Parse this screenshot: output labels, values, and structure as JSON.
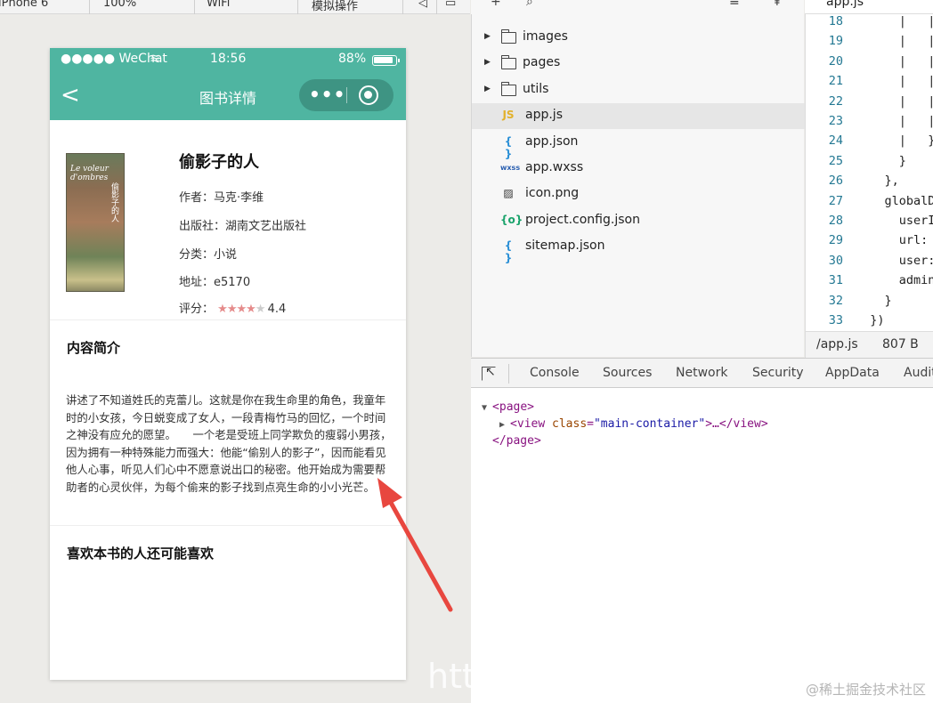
{
  "simulator_toolbar": {
    "device": "iPhone 6",
    "zoom": "100%",
    "network": "WiFi",
    "mode": "模拟操作"
  },
  "phone": {
    "status": {
      "carrier": "●●●●● WeChat",
      "time": "18:56",
      "battery": "88%"
    },
    "nav": {
      "back": "<",
      "title": "图书详情",
      "menu": "•••"
    },
    "book": {
      "cover_title": "Le voleur d'ombres",
      "cover_cn": "偷影子的人",
      "name": "偷影子的人",
      "author_label": "作者：",
      "author": "马克·李维",
      "publisher_label": "出版社：",
      "publisher": "湖南文艺出版社",
      "category_label": "分类：",
      "category": "小说",
      "address_label": "地址：",
      "address": "e5170",
      "rating_label": "评分：",
      "rating_value": "4.4",
      "rating_stars": 4,
      "rating_max": 5
    },
    "intro_title": "内容简介",
    "intro_text": "讲述了不知道姓氏的克蕾儿。这就是你在我生命里的角色，我童年时的小女孩，今日蜕变成了女人，一段青梅竹马的回忆，一个时间之神没有应允的愿望。　　一个老是受班上同学欺负的瘦弱小男孩，因为拥有一种特殊能力而强大：他能“偷别人的影子”，因而能看见他人心事，听见人们心中不愿意说出口的秘密。他开始成为需要帮助者的心灵伙伴，为每个偷来的影子找到点亮生命的小小光芒。",
    "recommend_title": "喜欢本书的人还可能喜欢"
  },
  "file_tree": [
    {
      "name": "images",
      "type": "folder",
      "icon": "folder-icon"
    },
    {
      "name": "pages",
      "type": "folder",
      "icon": "folder-icon"
    },
    {
      "name": "utils",
      "type": "folder",
      "icon": "folder-icon"
    },
    {
      "name": "app.js",
      "type": "file",
      "icon": "JS",
      "selected": true
    },
    {
      "name": "app.json",
      "type": "file",
      "icon": "{ }"
    },
    {
      "name": "app.wxss",
      "type": "file",
      "icon": "wxss"
    },
    {
      "name": "icon.png",
      "type": "file",
      "icon": "image-icon"
    },
    {
      "name": "project.config.json",
      "type": "file",
      "icon": "{o}"
    },
    {
      "name": "sitemap.json",
      "type": "file",
      "icon": "{ }"
    }
  ],
  "editor": {
    "tab": "app.js",
    "lines": [
      {
        "n": "18",
        "t": "      |   |   |"
      },
      {
        "n": "19",
        "t": "      |   |   |"
      },
      {
        "n": "20",
        "t": "      |   |   |"
      },
      {
        "n": "21",
        "t": "      |   |   |"
      },
      {
        "n": "22",
        "t": "      |   |   |"
      },
      {
        "n": "23",
        "t": "      |   |   }"
      },
      {
        "n": "24",
        "t": "      |   })"
      },
      {
        "n": "25",
        "t": "      }"
      },
      {
        "n": "26",
        "t": "    },"
      },
      {
        "n": "27",
        "t": "    globalD"
      },
      {
        "n": "28",
        "t": "      userI"
      },
      {
        "n": "29",
        "t": "      url: "
      },
      {
        "n": "30",
        "t": "      user:"
      },
      {
        "n": "31",
        "t": "      admin"
      },
      {
        "n": "32",
        "t": "    }"
      },
      {
        "n": "33",
        "t": "  })"
      }
    ],
    "status_path": "/app.js",
    "status_size": "807 B"
  },
  "devtools": {
    "tabs": [
      "Console",
      "Sources",
      "Network",
      "Security",
      "AppData",
      "Audit"
    ],
    "dom": {
      "open_tag": "<page>",
      "child_tag_open": "<view",
      "child_attr": "class",
      "child_val": "\"main-container\"",
      "child_rest": ">…</view>",
      "close_tag": "</page>"
    }
  },
  "watermark": {
    "left": "http",
    "right": "@稀土掘金技术社区"
  },
  "colors": {
    "nav_green": "#4fb5a1",
    "arrow_red": "#e8473f",
    "star": "#e58b8b"
  }
}
